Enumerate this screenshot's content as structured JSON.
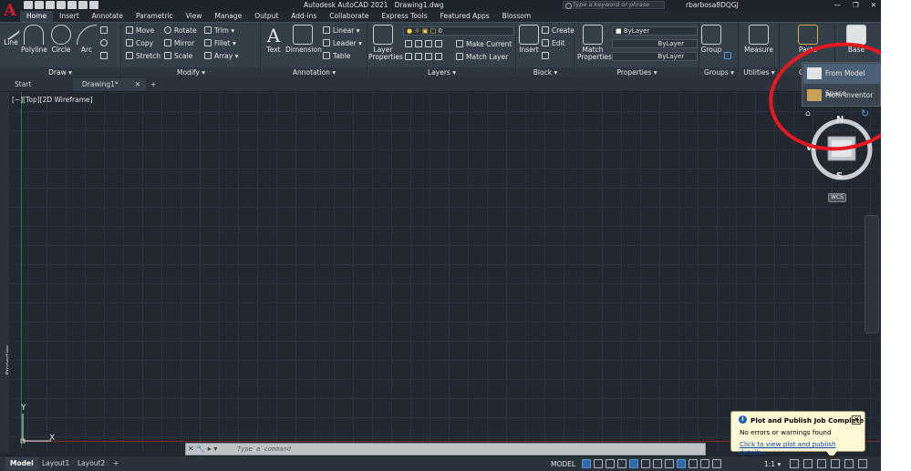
{
  "app": {
    "title": "Autodesk AutoCAD 2021",
    "document": "Drawing1.dwg",
    "logo_letter": "A",
    "search_placeholder": "Type a keyword or phrase",
    "user": "rbarbosa8DQGJ"
  },
  "window_buttons": {
    "minimize": "—",
    "restore": "❐",
    "close": "✕"
  },
  "ribbon_tabs": [
    "Home",
    "Insert",
    "Annotate",
    "Parametric",
    "View",
    "Manage",
    "Output",
    "Add-ins",
    "Collaborate",
    "Express Tools",
    "Featured Apps",
    "Blossom"
  ],
  "active_tab": "Home",
  "draw": {
    "title": "Draw ▾",
    "line": "Line",
    "polyline": "Polyline",
    "circle": "Circle",
    "arc": "Arc"
  },
  "modify": {
    "title": "Modify ▾",
    "move": "Move",
    "rotate": "Rotate",
    "trim": "Trim ▾",
    "copy": "Copy",
    "mirror": "Mirror",
    "fillet": "Fillet ▾",
    "stretch": "Stretch",
    "scale": "Scale",
    "array": "Array ▾"
  },
  "annotation": {
    "title": "Annotation ▾",
    "text": "Text",
    "dimension": "Dimension",
    "linear": "Linear ▾",
    "leader": "Leader ▾",
    "table": "Table"
  },
  "layers": {
    "title": "Layers ▾",
    "layer_properties": "Layer Properties",
    "current_layer": "0",
    "make_current": "Make Current",
    "match_layer": "Match Layer"
  },
  "block": {
    "title": "Block ▾",
    "insert": "Insert",
    "create": "Create",
    "edit": "Edit"
  },
  "properties": {
    "title": "Properties ▾",
    "match_properties": "Match Properties",
    "color": "ByLayer",
    "linetype": "ByLayer",
    "lineweight": "ByLayer"
  },
  "groups": {
    "title": "Groups ▾",
    "group": "Group"
  },
  "utilities": {
    "title": "Utilities ▾",
    "measure": "Measure"
  },
  "clipboard": {
    "title": "C",
    "paste": "Paste"
  },
  "view_panel": {
    "base": "Base"
  },
  "base_dropdown": {
    "item1": "From Model Space",
    "item2": "From Inventor"
  },
  "doc_tabs": {
    "start": "Start",
    "drawing": "Drawing1*",
    "close": "✕",
    "new": "+"
  },
  "viewport_label": "[−][Top][2D Wireframe]",
  "properties_palette_label": "Properties",
  "viewcube": {
    "north": "N",
    "south": "S",
    "west": "W",
    "east": "E",
    "top": "TOP",
    "wcs": "WCS"
  },
  "ucs": {
    "x": "X",
    "y": "Y"
  },
  "command": {
    "placeholder": "Type a command"
  },
  "layout_tabs": {
    "model": "Model",
    "layout1": "Layout1",
    "layout2": "Layout2",
    "add": "+"
  },
  "status": {
    "model_space": "MODEL",
    "scale": "1:1 ▾"
  },
  "notification": {
    "title": "Plot and Publish Job Complete",
    "message": "No errors or warnings found",
    "link": "Click to view plot and publish details..."
  },
  "colors": {
    "canvas": "#212830",
    "ribbon": "#353f4a",
    "annotation_circle": "#e8181f",
    "accent": "#2f6aa8"
  }
}
